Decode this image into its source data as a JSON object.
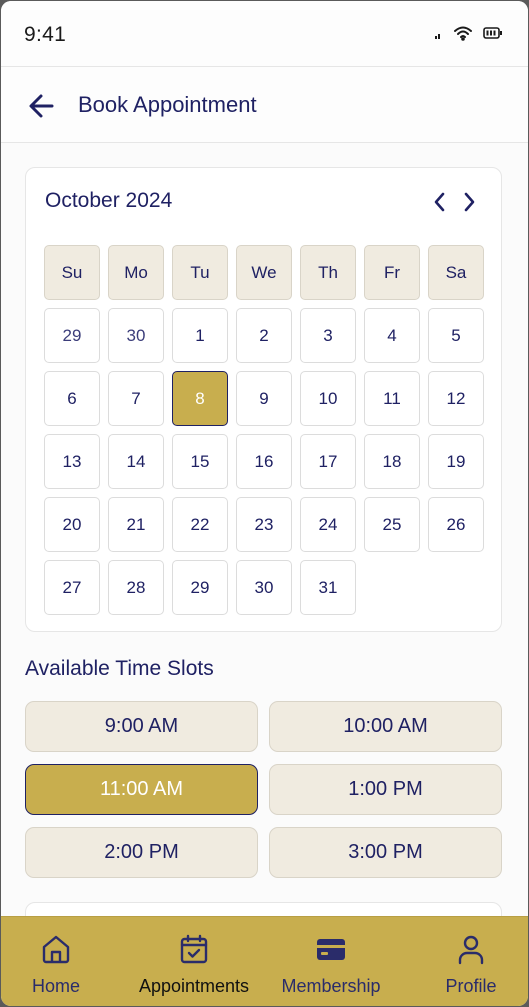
{
  "status_bar": {
    "time": "9:41"
  },
  "header": {
    "title": "Book Appointment"
  },
  "calendar": {
    "month_label": "October 2024",
    "weekdays": [
      "Su",
      "Mo",
      "Tu",
      "We",
      "Th",
      "Fr",
      "Sa"
    ],
    "days": [
      {
        "label": "29",
        "muted": true
      },
      {
        "label": "30",
        "muted": true
      },
      {
        "label": "1"
      },
      {
        "label": "2"
      },
      {
        "label": "3"
      },
      {
        "label": "4"
      },
      {
        "label": "5"
      },
      {
        "label": "6"
      },
      {
        "label": "7"
      },
      {
        "label": "8",
        "selected": true
      },
      {
        "label": "9"
      },
      {
        "label": "10"
      },
      {
        "label": "11"
      },
      {
        "label": "12"
      },
      {
        "label": "13"
      },
      {
        "label": "14"
      },
      {
        "label": "15"
      },
      {
        "label": "16"
      },
      {
        "label": "17"
      },
      {
        "label": "18"
      },
      {
        "label": "19"
      },
      {
        "label": "20"
      },
      {
        "label": "21"
      },
      {
        "label": "22"
      },
      {
        "label": "23"
      },
      {
        "label": "24"
      },
      {
        "label": "25"
      },
      {
        "label": "26"
      },
      {
        "label": "27"
      },
      {
        "label": "28"
      },
      {
        "label": "29"
      },
      {
        "label": "30"
      },
      {
        "label": "31"
      }
    ]
  },
  "time_slots": {
    "title": "Available Time Slots",
    "slots": [
      {
        "label": "9:00 AM"
      },
      {
        "label": "10:00 AM"
      },
      {
        "label": "11:00 AM",
        "selected": true
      },
      {
        "label": "1:00 PM"
      },
      {
        "label": "2:00 PM"
      },
      {
        "label": "3:00 PM"
      }
    ]
  },
  "bottom_nav": {
    "items": [
      {
        "label": "Home",
        "icon": "home-icon"
      },
      {
        "label": "Appointments",
        "icon": "calendar-check-icon",
        "active": true
      },
      {
        "label": "Membership",
        "icon": "card-icon"
      },
      {
        "label": "Profile",
        "icon": "user-icon"
      }
    ]
  },
  "colors": {
    "navy": "#1f2163",
    "gold": "#c8ae4e",
    "beige": "#f0ebe0"
  }
}
